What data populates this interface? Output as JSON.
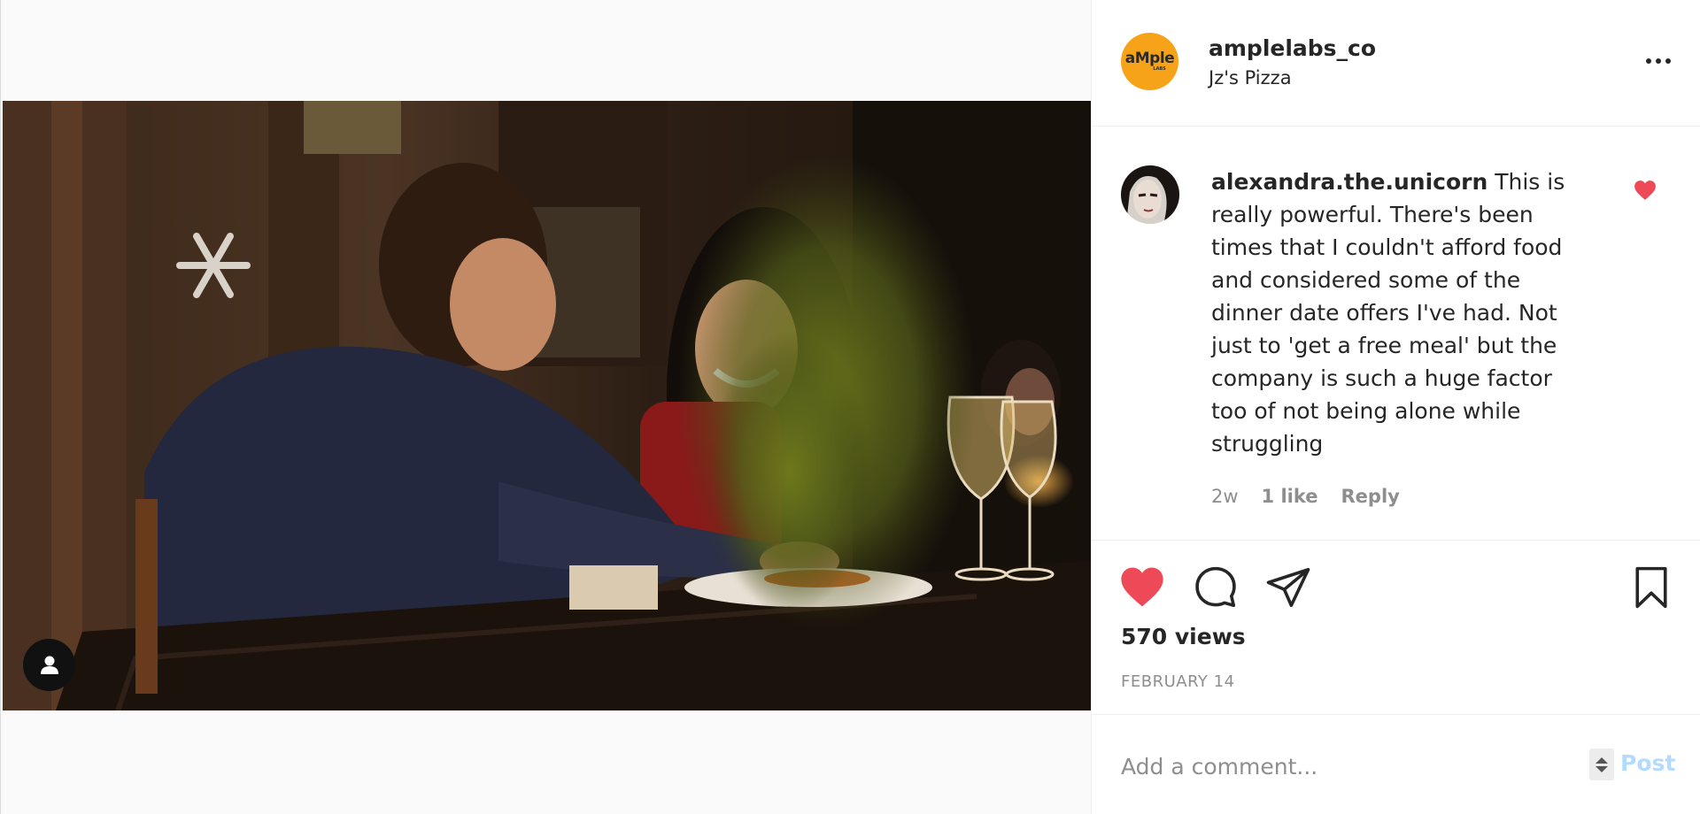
{
  "post": {
    "author": "amplelabs_co",
    "location": "Jz's Pizza",
    "avatar_text": "aMple",
    "avatar_subtext": "LABS",
    "avatar_color": "#f7a31a",
    "views": "570 views",
    "date": "FEBRUARY 14"
  },
  "comment": {
    "username": "alexandra.the.unicorn",
    "text": "This is really powerful. There's been times that I couldn't afford food and considered some of the dinner date offers I've had. Not just to 'get a free meal' but the company is such a huge factor too of not being alone while struggling",
    "age": "2w",
    "likes": "1 like",
    "reply_label": "Reply",
    "liked": true
  },
  "actions": {
    "like_icon": "heart-filled-icon",
    "comment_icon": "speech-bubble-icon",
    "share_icon": "paper-plane-icon",
    "save_icon": "bookmark-icon",
    "like_color": "#ed4956"
  },
  "add_comment": {
    "placeholder": "Add a comment...",
    "post_label": "Post"
  },
  "colors": {
    "muted_text": "#8e8e8e",
    "post_button_disabled": "#b3dbff",
    "divider": "#efefef"
  }
}
